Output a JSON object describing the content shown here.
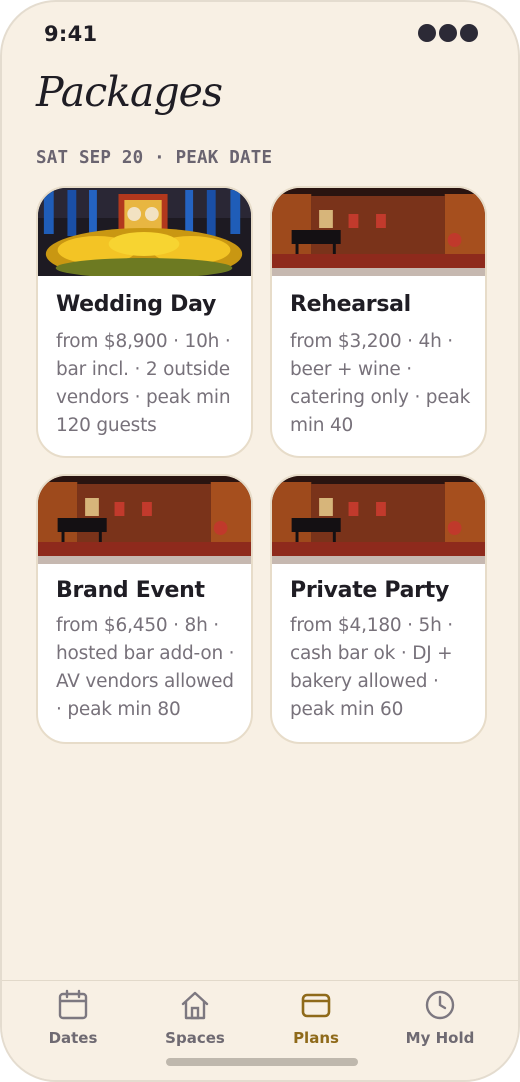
{
  "status": {
    "time": "9:41"
  },
  "header": {
    "title": "Packages",
    "date_label": "SAT SEP 20 · PEAK DATE"
  },
  "packages": [
    {
      "title": "Wedding Day",
      "description": "from $8,900 · 10h · bar incl. · 2 outside vendors · peak min 120 guests"
    },
    {
      "title": "Rehearsal",
      "description": "from $3,200 · 4h · beer + wine · catering only · peak min 40"
    },
    {
      "title": "Brand Event",
      "description": "from $6,450 · 8h · hosted bar add-on · AV vendors allowed · peak min 80"
    },
    {
      "title": "Private Party",
      "description": "from $4,180 · 5h · cash bar ok · DJ + bakery allowed · peak min 60"
    }
  ],
  "tabs": [
    {
      "label": "Dates",
      "icon": "calendar-icon"
    },
    {
      "label": "Spaces",
      "icon": "home-icon"
    },
    {
      "label": "Plans",
      "icon": "wallet-icon",
      "active": true
    },
    {
      "label": "My Hold",
      "icon": "clock-icon"
    }
  ],
  "colors": {
    "background": "#f8f0e4",
    "accent": "#8f6a1a",
    "text": "#1f1d24",
    "muted": "#77717a"
  }
}
